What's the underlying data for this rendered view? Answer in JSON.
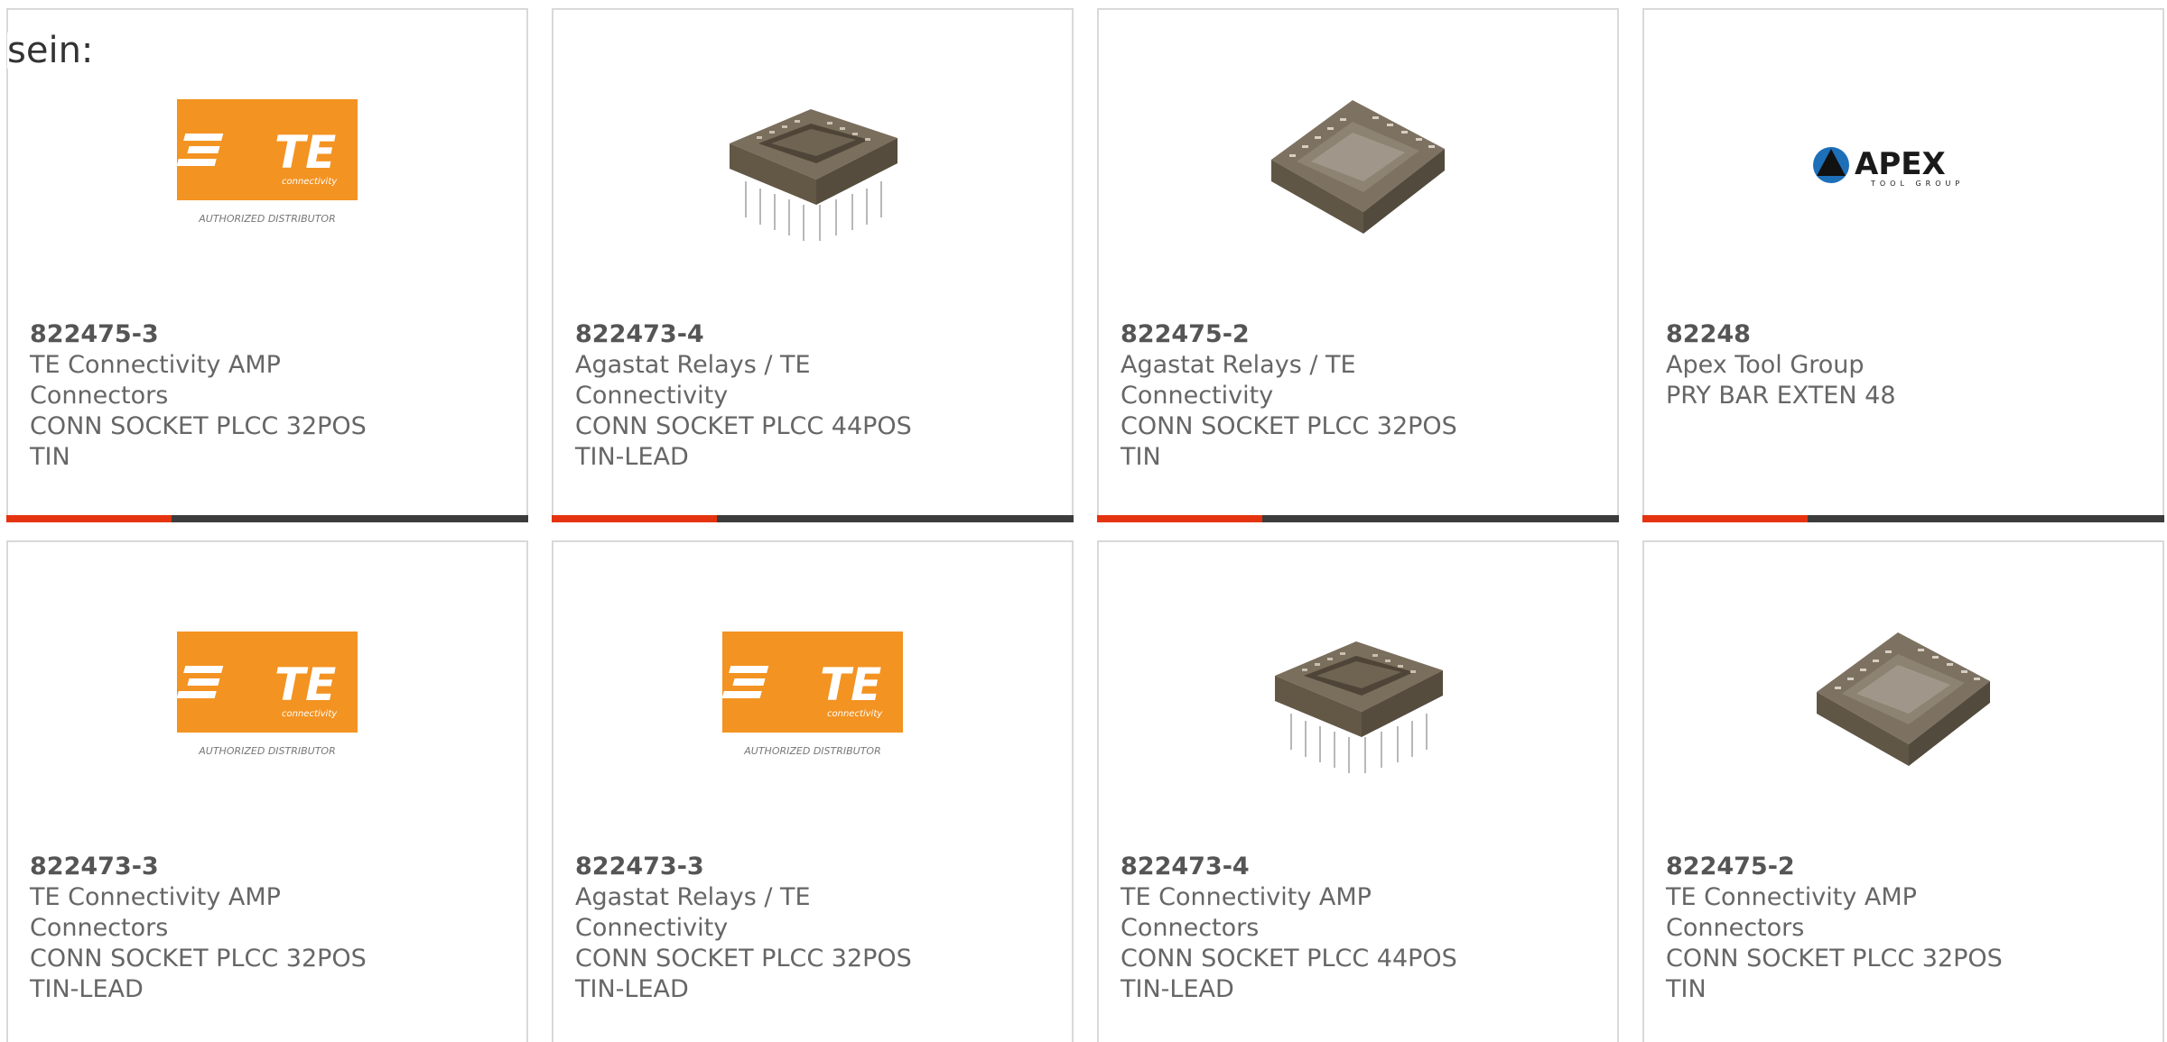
{
  "intro_text": "sein:",
  "colors": {
    "accent": "#e5330f",
    "bar": "#3c3c3c",
    "te_orange": "#f39322",
    "card_border": "#d9d9d9"
  },
  "logos": {
    "te_logo_text": "TE",
    "te_logo_sub": "connectivity",
    "te_logo_caption": "AUTHORIZED DISTRIBUTOR",
    "apex_logo_text": "APEX",
    "apex_logo_sub": "TOOL GROUP"
  },
  "products": [
    {
      "part": "822475-3",
      "manufacturer": "TE Connectivity AMP Connectors",
      "description": "CONN SOCKET PLCC 32POS TIN",
      "image_icon": "te-logo-icon"
    },
    {
      "part": "822473-4",
      "manufacturer": "Agastat Relays / TE Connectivity",
      "description": "CONN SOCKET PLCC 44POS TIN-LEAD",
      "image_icon": "plcc-socket-pins-icon"
    },
    {
      "part": "822475-2",
      "manufacturer": "Agastat Relays / TE Connectivity",
      "description": "CONN SOCKET PLCC 32POS TIN",
      "image_icon": "plcc-socket-icon"
    },
    {
      "part": "82248",
      "manufacturer": "Apex Tool Group",
      "description": "PRY BAR EXTEN 48",
      "image_icon": "apex-logo-icon"
    },
    {
      "part": "822473-3",
      "manufacturer": "TE Connectivity AMP Connectors",
      "description": "CONN SOCKET PLCC 32POS TIN-LEAD",
      "image_icon": "te-logo-icon"
    },
    {
      "part": "822473-3",
      "manufacturer": "Agastat Relays / TE Connectivity",
      "description": "CONN SOCKET PLCC 32POS TIN-LEAD",
      "image_icon": "te-logo-icon"
    },
    {
      "part": "822473-4",
      "manufacturer": "TE Connectivity AMP Connectors",
      "description": "CONN SOCKET PLCC 44POS TIN-LEAD",
      "image_icon": "plcc-socket-pins-icon"
    },
    {
      "part": "822475-2",
      "manufacturer": "TE Connectivity AMP Connectors",
      "description": "CONN SOCKET PLCC 32POS TIN",
      "image_icon": "plcc-socket-icon"
    }
  ]
}
